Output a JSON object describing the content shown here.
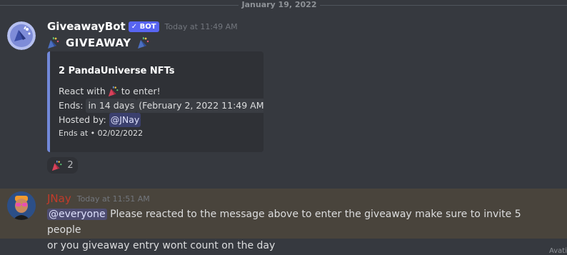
{
  "divider": {
    "date": "January 19, 2022"
  },
  "messages": [
    {
      "author": "GiveawayBot",
      "badge": "✓ BOT",
      "timestamp": "Today at 11:49 AM",
      "headline": "GIVEAWAY",
      "embed": {
        "title": "2 PandaUniverse NFTs",
        "react_prefix": "React with",
        "react_suffix": "to enter!",
        "ends_label": "Ends:",
        "ends_value": "in 14 days",
        "ends_paren": "(February 2, 2022 11:49 AM)",
        "hosted_label": "Hosted by:",
        "hosted_mention": "@JNay",
        "footer": "Ends at • 02/02/2022"
      },
      "reaction": {
        "icon": "party-popper-icon",
        "count": "2"
      }
    },
    {
      "author": "JNay",
      "timestamp": "Today at 11:51 AM",
      "mention": "@everyone",
      "text_line1": "Please reacted to the message above to enter the giveaway make sure to invite 5 people",
      "text_line2": "or you giveaway entry wont count on the day"
    }
  ],
  "colors": {
    "background": "#36393f",
    "embed_bar": "#7289da",
    "bot_badge": "#5865f2",
    "highlight_bg": "#49443c",
    "jnay_name": "#c13b2a"
  },
  "corner_text": "Avati"
}
